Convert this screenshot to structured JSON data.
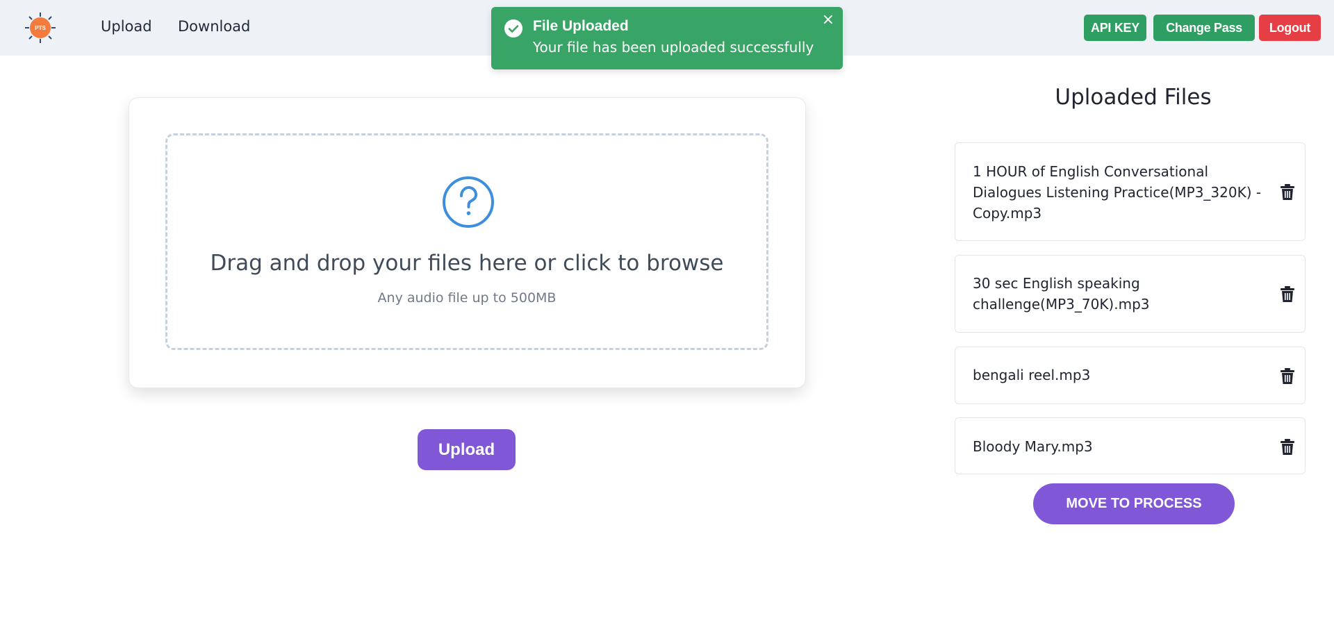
{
  "header": {
    "logo_text": "PTS",
    "nav": [
      "Upload",
      "Download"
    ],
    "buttons": {
      "api_key": "API KEY",
      "change_pass": "Change Pass",
      "logout": "Logout"
    }
  },
  "toast": {
    "title": "File Uploaded",
    "message": "Your file has been uploaded successfully",
    "close": "×"
  },
  "dropzone": {
    "title": "Drag and drop your files here or click to browse",
    "subtitle": "Any audio file up to 500MB"
  },
  "upload_button": "Upload",
  "files": {
    "heading": "Uploaded Files",
    "items": [
      {
        "name": "1 HOUR of English Conversational Dialogues Listening Practice(MP3_320K) - Copy.mp3"
      },
      {
        "name": "30 sec English speaking challenge(MP3_70K).mp3"
      },
      {
        "name": "bengali reel.mp3"
      },
      {
        "name": "Bloody Mary.mp3"
      }
    ],
    "move_button": "MOVE TO PROCESS"
  },
  "colors": {
    "header_bg": "#eef2f6",
    "success": "#2f9e63",
    "danger": "#e53f45",
    "primary": "#8057d6",
    "toast_bg": "#38a465"
  }
}
